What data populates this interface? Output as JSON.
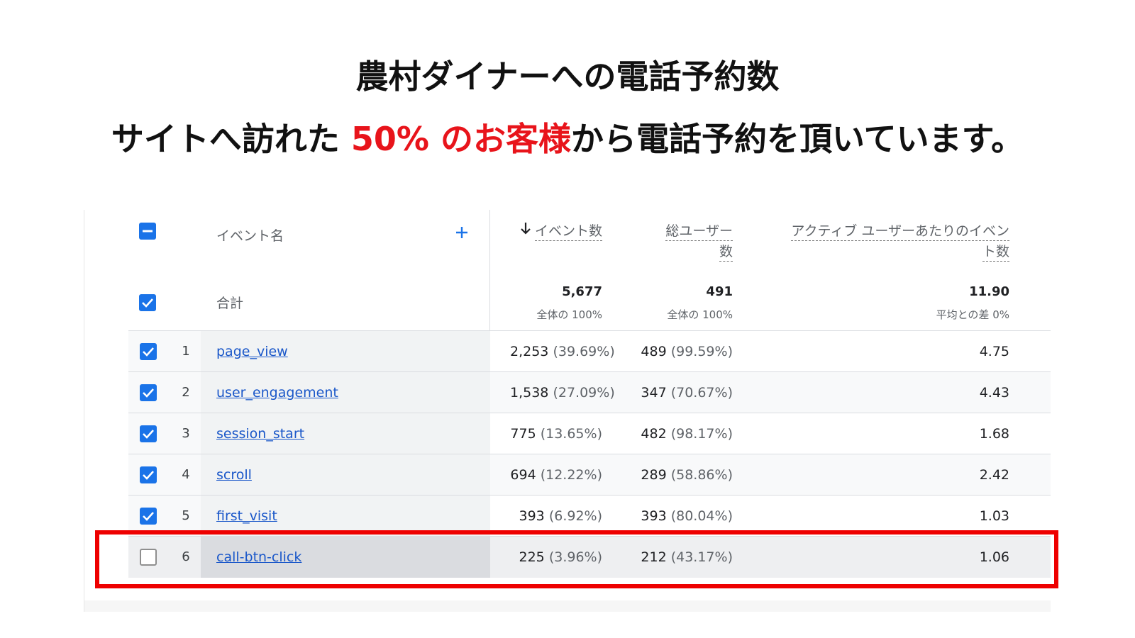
{
  "title": "農村ダイナーへの電話予約数",
  "subtitle": {
    "before": "サイトへ訪れた ",
    "highlight": "50% のお客様",
    "after": "から電話予約を頂いています。"
  },
  "colors": {
    "accent_red": "#e8141b",
    "checkbox_blue": "#1a73e8",
    "link_blue": "#1a57c9"
  },
  "table": {
    "header": {
      "event_name": "イベント名",
      "add_icon": "plus-icon",
      "sort_icon": "arrow-down-icon",
      "event_count": "イベント数",
      "total_users_line1": "総ユーザー",
      "total_users_line2": "数",
      "per_user_line1": "アクティブ ユーザーあたりのイベン",
      "per_user_line2": "ト数"
    },
    "total": {
      "label": "合計",
      "event_count": "5,677",
      "event_count_sub": "全体の 100%",
      "total_users": "491",
      "total_users_sub": "全体の 100%",
      "per_user": "11.90",
      "per_user_sub": "平均との差 0%"
    },
    "rows": [
      {
        "index": "1",
        "name": "page_view",
        "count": "2,253",
        "count_pct": "(39.69%)",
        "users": "489",
        "users_pct": "(99.59%)",
        "per_user": "4.75",
        "checked": true
      },
      {
        "index": "2",
        "name": "user_engagement",
        "count": "1,538",
        "count_pct": "(27.09%)",
        "users": "347",
        "users_pct": "(70.67%)",
        "per_user": "4.43",
        "checked": true
      },
      {
        "index": "3",
        "name": "session_start",
        "count": "775",
        "count_pct": "(13.65%)",
        "users": "482",
        "users_pct": "(98.17%)",
        "per_user": "1.68",
        "checked": true
      },
      {
        "index": "4",
        "name": "scroll",
        "count": "694",
        "count_pct": "(12.22%)",
        "users": "289",
        "users_pct": "(58.86%)",
        "per_user": "2.42",
        "checked": true
      },
      {
        "index": "5",
        "name": "first_visit",
        "count": "393",
        "count_pct": "(6.92%)",
        "users": "393",
        "users_pct": "(80.04%)",
        "per_user": "1.03",
        "checked": true
      },
      {
        "index": "6",
        "name": "call-btn-click",
        "count": "225",
        "count_pct": "(3.96%)",
        "users": "212",
        "users_pct": "(43.17%)",
        "per_user": "1.06",
        "checked": false
      }
    ]
  }
}
